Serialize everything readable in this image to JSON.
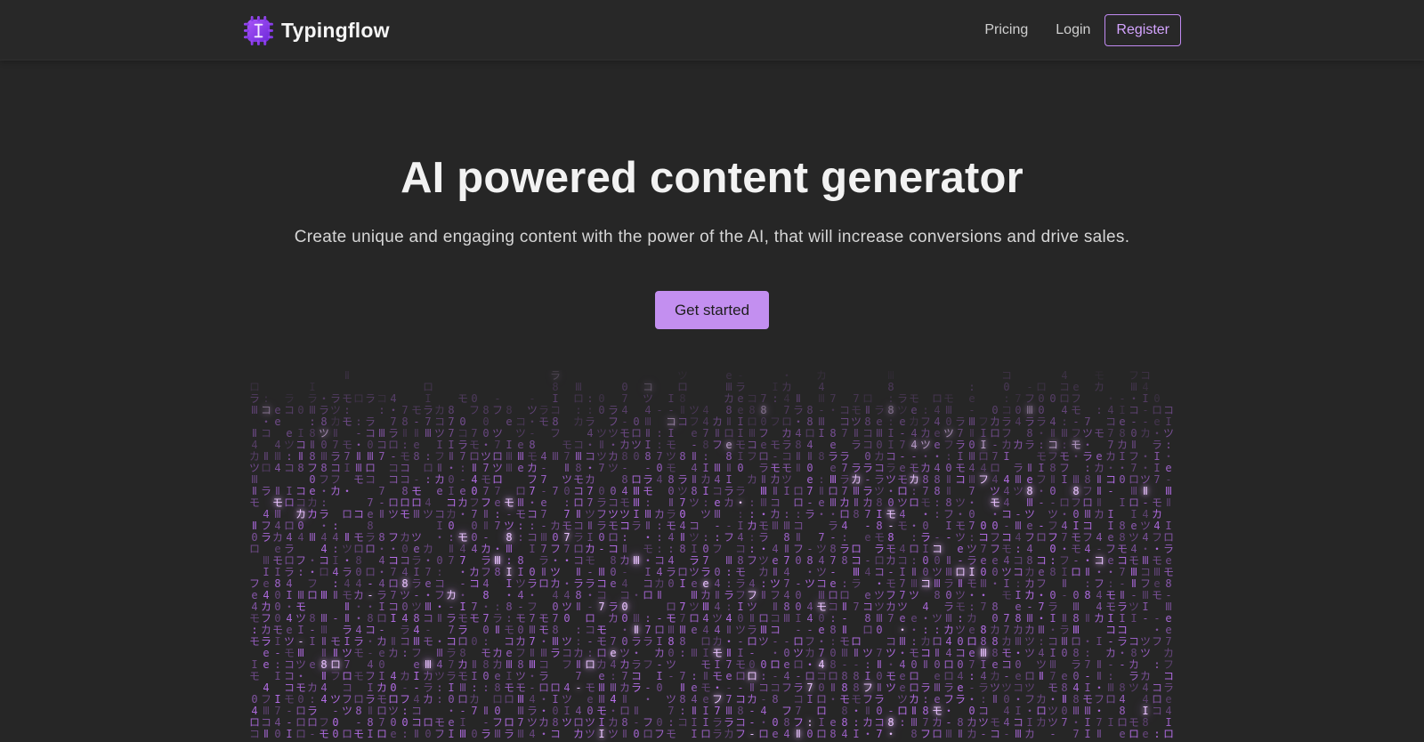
{
  "brand": {
    "name": "Typingflow",
    "logo_icon": "cursor-chip-logo-icon",
    "accent": "#8b5cf6"
  },
  "nav": {
    "pricing": "Pricing",
    "login": "Login",
    "register": "Register"
  },
  "hero": {
    "title": "AI powered content generator",
    "subtitle": "Create unique and engaging content with the power of the AI, that will increase conversions and drive sales.",
    "cta": "Get started"
  },
  "colors": {
    "background": "#262626",
    "cta_fill": "#c38ff0",
    "register_border": "#c18af2",
    "matrix_glyph": "#b56ee8",
    "matrix_glow": "#e9c2ff"
  },
  "matrix": {
    "glyphs": [
      "コ",
      "ラ",
      "ロ",
      "ツ",
      "Ⅱ",
      "Ⅲ",
      "I",
      "e",
      "4",
      "7",
      "0",
      "8",
      "フ",
      "モ",
      "・",
      ":",
      "-",
      "カ"
    ]
  }
}
